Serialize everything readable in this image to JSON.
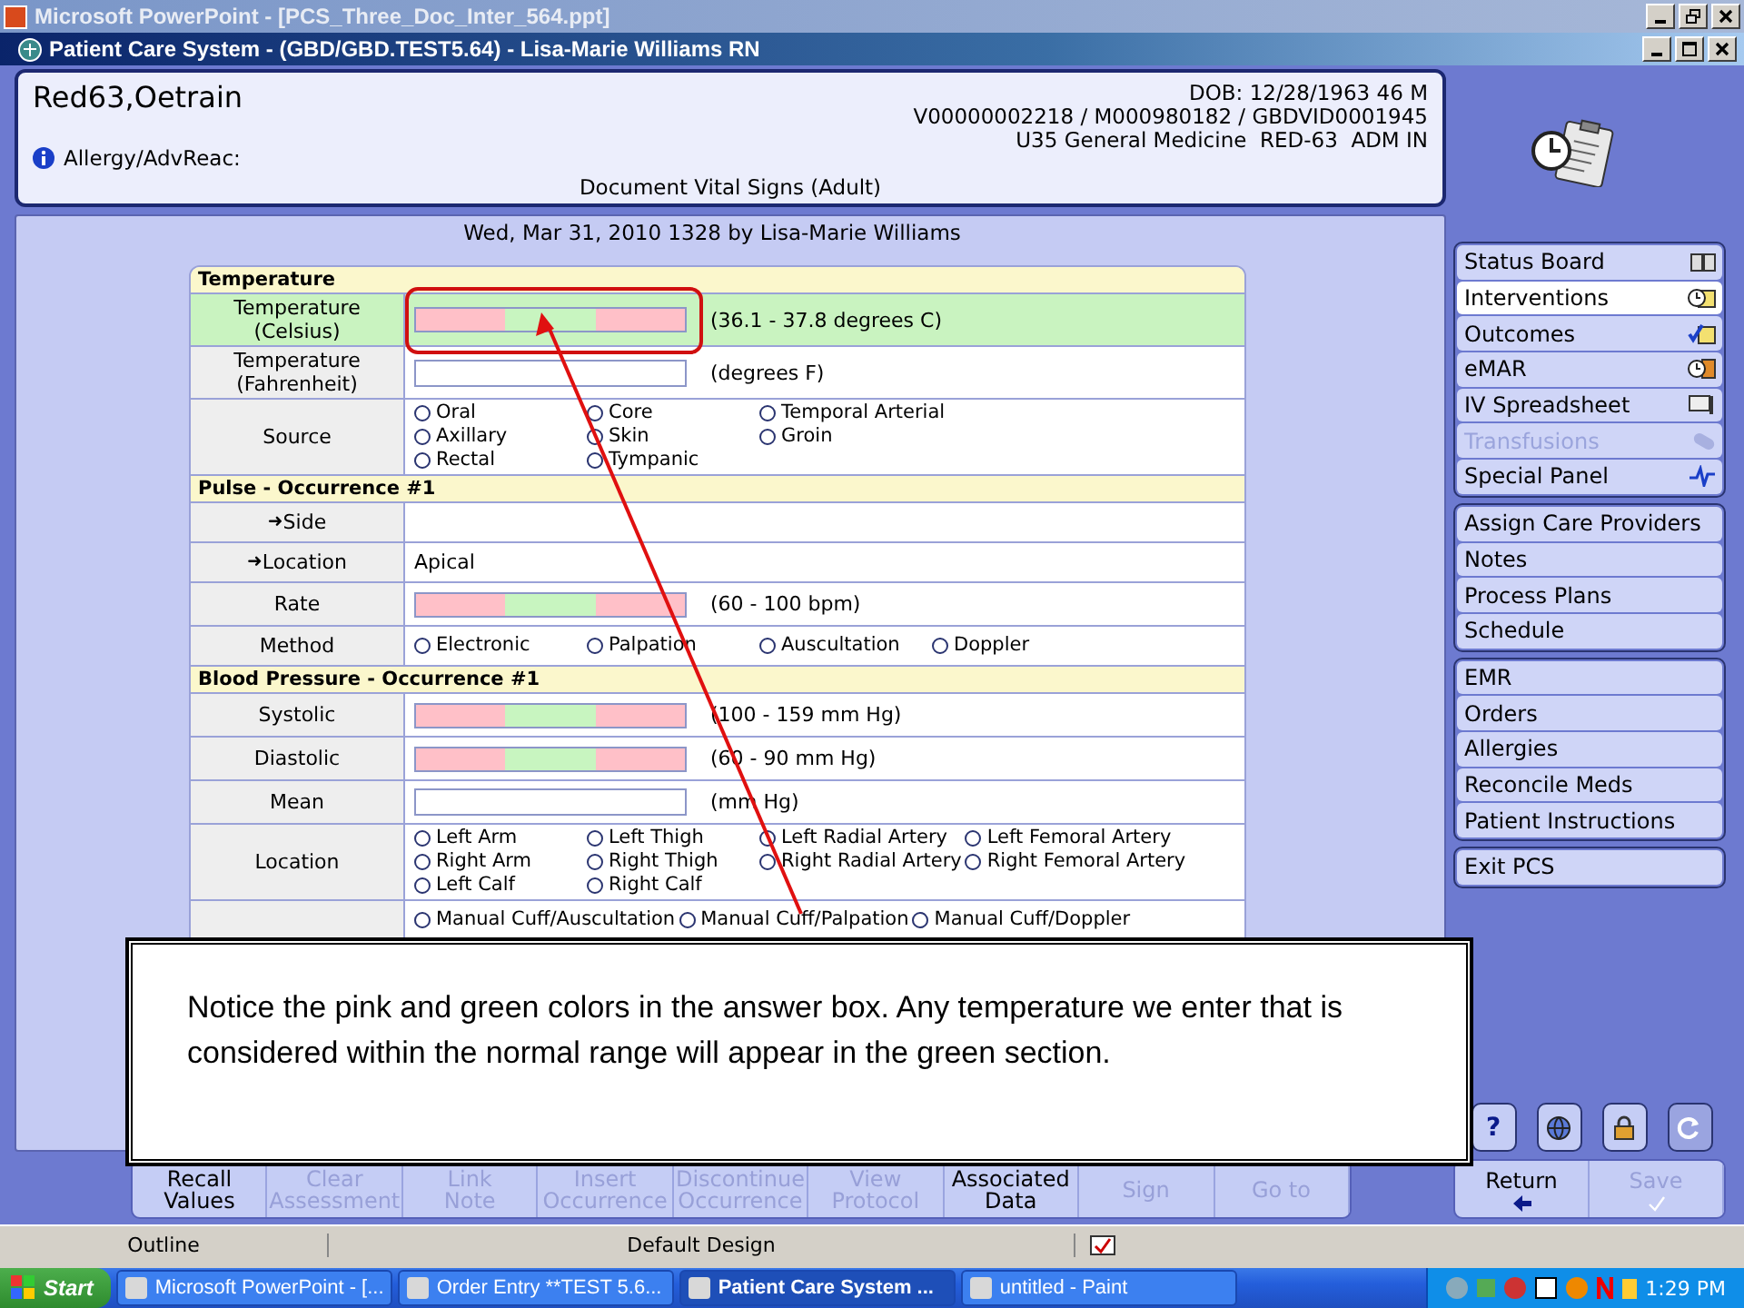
{
  "ppt_window": {
    "title": "Microsoft PowerPoint - [PCS_Three_Doc_Inter_564.ppt]"
  },
  "app_window": {
    "title": "Patient Care System - (GBD/GBD.TEST5.64) - Lisa-Marie Williams RN"
  },
  "patient": {
    "name": "Red63,Oetrain",
    "dob": "DOB: 12/28/1963 46 M",
    "ids": "V00000002218 / M000980182 / GBDVID0001945",
    "location": "U35 General Medicine  RED-63  ADM IN",
    "allergy_label": "Allergy/AdvReac:",
    "document": "Document Vital Signs (Adult)"
  },
  "entry_line": "Wed, Mar 31, 2010 1328  by  Lisa-Marie Williams",
  "form": {
    "sections": [
      {
        "title": "Temperature",
        "rows": [
          {
            "label": "Temperature (Celsius)",
            "kind": "range",
            "range": "(36.1 - 37.8 degrees C)",
            "highlighted": true
          },
          {
            "label": "Temperature (Fahrenheit)",
            "kind": "text",
            "range": "(degrees F)",
            "highlighted": false
          },
          {
            "label": "Source",
            "kind": "radio",
            "highlighted": false,
            "columns": [
              [
                {
                  "label": "Oral",
                  "selected": false
                },
                {
                  "label": "Axillary",
                  "selected": false
                },
                {
                  "label": "Rectal",
                  "selected": false
                }
              ],
              [
                {
                  "label": "Core",
                  "selected": false
                },
                {
                  "label": "Skin",
                  "selected": false
                },
                {
                  "label": "Tympanic",
                  "selected": false
                }
              ],
              [
                {
                  "label": "Temporal Arterial",
                  "selected": false
                },
                {
                  "label": "Groin",
                  "selected": false
                }
              ]
            ]
          }
        ]
      },
      {
        "title": "Pulse - Occurrence #1",
        "rows": [
          {
            "label": "Side",
            "kind": "value",
            "arrow": "➜",
            "highlighted": false
          },
          {
            "label": "Location",
            "kind": "value",
            "arrow": "➜",
            "value": "Apical",
            "highlighted": false
          },
          {
            "label": "Rate",
            "kind": "range",
            "range": "(60 - 100 bpm)",
            "highlighted": false
          },
          {
            "label": "Method",
            "kind": "radio",
            "highlighted": false,
            "columns": [
              [
                {
                  "label": "Electronic",
                  "selected": false
                }
              ],
              [
                {
                  "label": "Palpation",
                  "selected": false
                }
              ],
              [
                {
                  "label": "Auscultation",
                  "selected": false
                }
              ],
              [
                {
                  "label": "Doppler",
                  "selected": false
                }
              ]
            ]
          }
        ]
      },
      {
        "title": "Blood Pressure - Occurrence #1",
        "rows": [
          {
            "label": "Systolic",
            "kind": "range",
            "range": "(100 - 159 mm Hg)",
            "highlighted": false
          },
          {
            "label": "Diastolic",
            "kind": "range",
            "range": "(60 - 90 mm Hg)",
            "highlighted": false
          },
          {
            "label": "Mean",
            "kind": "text",
            "range": "(mm Hg)",
            "highlighted": false
          },
          {
            "label": "Location",
            "kind": "radio",
            "highlighted": false,
            "columns": [
              [
                {
                  "label": "Left Arm",
                  "selected": false
                },
                {
                  "label": "Right Arm",
                  "selected": false
                },
                {
                  "label": "Left Calf",
                  "selected": false
                }
              ],
              [
                {
                  "label": "Left Thigh",
                  "selected": false
                },
                {
                  "label": "Right Thigh",
                  "selected": false
                },
                {
                  "label": "Right Calf",
                  "selected": false
                }
              ],
              [
                {
                  "label": "Left Radial Artery",
                  "selected": false
                },
                {
                  "label": "Right Radial Artery",
                  "selected": false
                }
              ],
              [
                {
                  "label": "Left Femoral Artery",
                  "selected": false
                },
                {
                  "label": "Right Femoral Artery",
                  "selected": false
                }
              ]
            ]
          },
          {
            "kind": "radio",
            "highlighted": false,
            "columns": [
              [
                {
                  "label": "Manual Cuff/Auscultation",
                  "selected": false
                }
              ],
              [
                {
                  "label": "Manual Cuff/Palpation",
                  "selected": false
                }
              ],
              [
                {
                  "label": "Manual Cuff/Doppler",
                  "selected": false
                }
              ]
            ]
          }
        ]
      }
    ]
  },
  "sidebar": {
    "groups": [
      [
        {
          "label": "Status Board",
          "selected": false,
          "disabled": false
        },
        {
          "label": "Interventions",
          "selected": true,
          "disabled": false
        },
        {
          "label": "Outcomes",
          "selected": false,
          "disabled": false
        },
        {
          "label": "eMAR",
          "selected": false,
          "disabled": false
        },
        {
          "label": "IV Spreadsheet",
          "selected": false,
          "disabled": false
        },
        {
          "label": "Transfusions",
          "selected": false,
          "disabled": true
        },
        {
          "label": "Special Panel",
          "selected": false,
          "disabled": false
        }
      ],
      [
        {
          "label": "Assign Care Providers",
          "selected": false,
          "disabled": false
        },
        {
          "label": "Notes",
          "selected": false,
          "disabled": false
        },
        {
          "label": "Process Plans",
          "selected": false,
          "disabled": false
        },
        {
          "label": "Schedule",
          "selected": false,
          "disabled": false
        }
      ],
      [
        {
          "label": "EMR",
          "selected": false,
          "disabled": false
        },
        {
          "label": "Orders",
          "selected": false,
          "disabled": false
        },
        {
          "label": "Allergies",
          "selected": false,
          "disabled": false
        },
        {
          "label": "Reconcile Meds",
          "selected": false,
          "disabled": false
        },
        {
          "label": "Patient Instructions",
          "selected": false,
          "disabled": false
        }
      ],
      [
        {
          "label": "Exit PCS",
          "selected": false,
          "disabled": false
        }
      ]
    ]
  },
  "callout": "Notice the pink and green colors in the answer box. Any temperature we enter that is considered within the normal range will appear in the green section.",
  "tool_buttons": [
    {
      "kind": "help",
      "glyph": "?",
      "disabled": false
    },
    {
      "kind": "globe",
      "disabled": false
    },
    {
      "kind": "lock",
      "disabled": false
    },
    {
      "kind": "refresh",
      "disabled": true
    }
  ],
  "bottom_buttons": [
    {
      "lines": [
        "Recall",
        "Values"
      ],
      "disabled": false
    },
    {
      "lines": [
        "Clear",
        "Assessment"
      ],
      "disabled": true
    },
    {
      "lines": [
        "Link",
        "Note"
      ],
      "disabled": true
    },
    {
      "lines": [
        "Insert",
        "Occurrence"
      ],
      "disabled": true
    },
    {
      "lines": [
        "Discontinue",
        "Occurrence"
      ],
      "disabled": true
    },
    {
      "lines": [
        "View",
        "Protocol"
      ],
      "disabled": true
    },
    {
      "lines": [
        "Associated",
        "Data"
      ],
      "disabled": false
    },
    {
      "lines": [
        "Sign"
      ],
      "disabled": true
    },
    {
      "lines": [
        "Go to"
      ],
      "disabled": true
    }
  ],
  "nav_buttons": [
    {
      "label": "Return",
      "kind": "return",
      "disabled": false
    },
    {
      "label": "Save",
      "kind": "save",
      "disabled": true
    }
  ],
  "ppt_status": [
    "Outline",
    "Default Design"
  ],
  "taskbar": {
    "start": "Start",
    "tasks": [
      {
        "label": "Microsoft PowerPoint - [...",
        "selected": false
      },
      {
        "label": "Order Entry **TEST 5.6...",
        "selected": false
      },
      {
        "label": "Patient Care System ...",
        "selected": true
      },
      {
        "label": "untitled - Paint",
        "selected": false
      }
    ],
    "clock": "1:29 PM"
  }
}
